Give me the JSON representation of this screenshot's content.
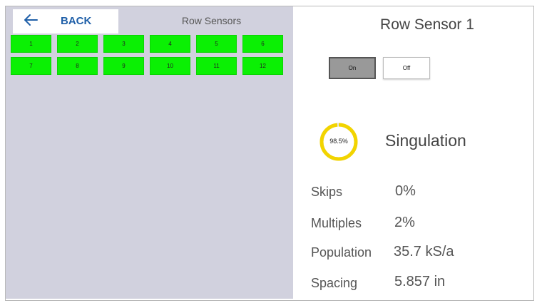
{
  "nav": {
    "back_label": "BACK"
  },
  "left_panel": {
    "title": "Row Sensors",
    "sensors": [
      "1",
      "2",
      "3",
      "4",
      "5",
      "6",
      "7",
      "8",
      "9",
      "10",
      "11",
      "12"
    ],
    "sensor_color": "#0bf004"
  },
  "detail": {
    "title": "Row Sensor  1",
    "toggle": {
      "on_label": "On",
      "off_label": "Off",
      "selected": "On"
    },
    "singulation": {
      "value": 0.985,
      "label": "98.5%",
      "name": "Singulation",
      "color": "#f2d400"
    },
    "stats": [
      {
        "label": "Skips",
        "value": "0%"
      },
      {
        "label": "Multiples",
        "value": "2%"
      },
      {
        "label": "Population",
        "value": "35.7 kS/a"
      },
      {
        "label": "Spacing",
        "value": "5.857 in"
      }
    ]
  }
}
